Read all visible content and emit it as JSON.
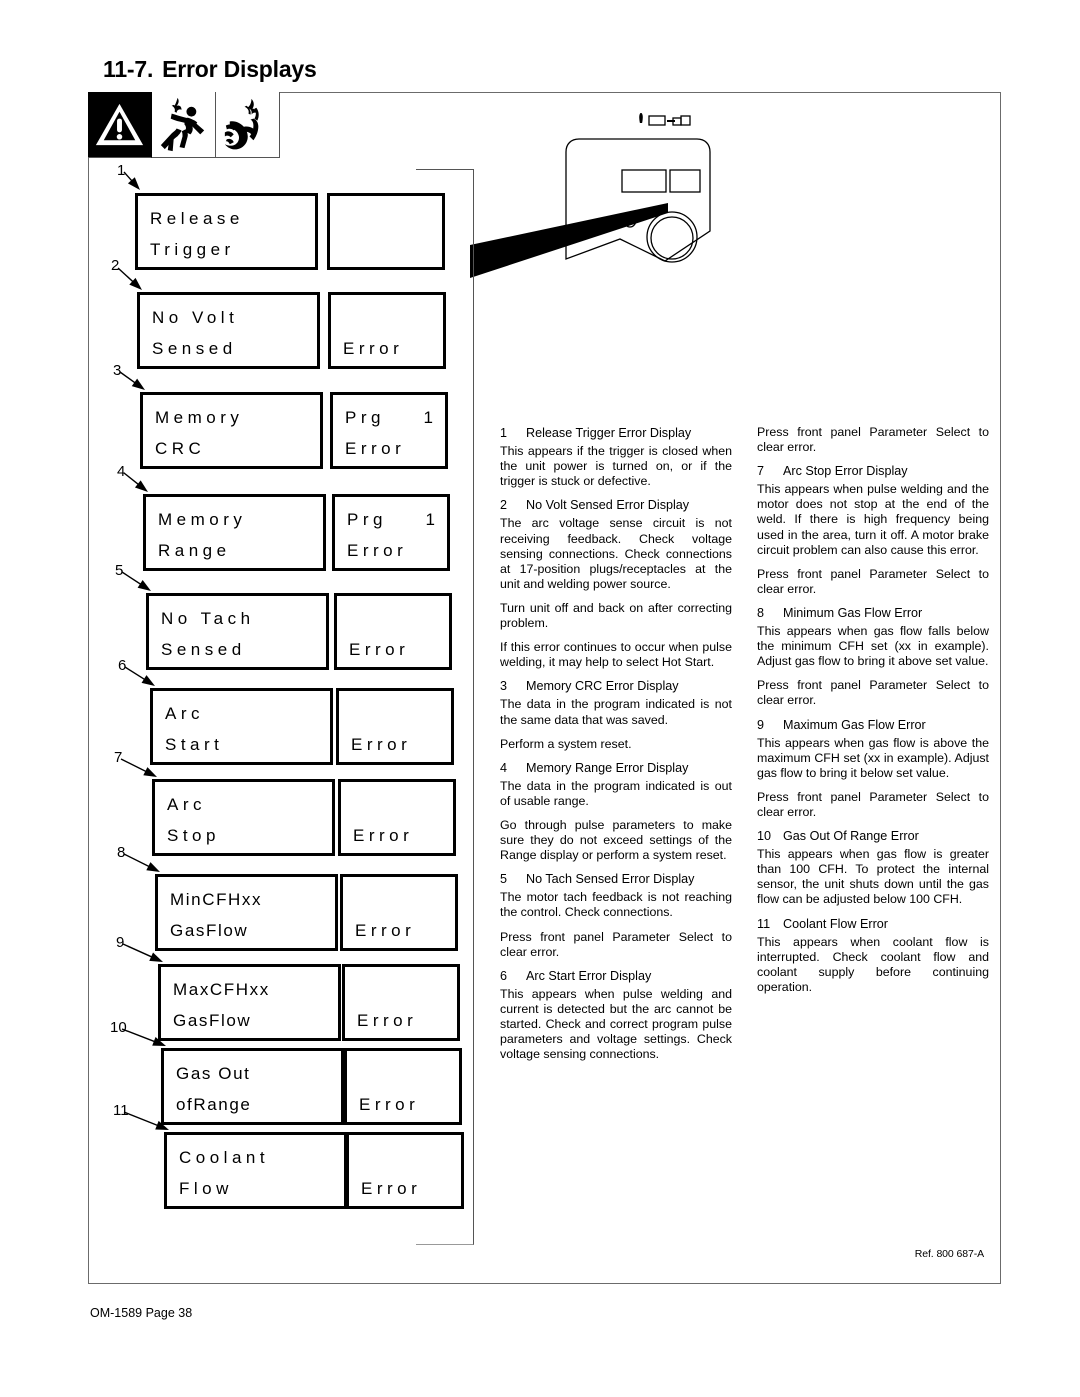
{
  "heading": {
    "number": "11-7.",
    "title": "Error Displays"
  },
  "safety_icons": [
    {
      "name": "warning-triangle-icon",
      "label": "Warning"
    },
    {
      "name": "electric-shock-icon",
      "label": "Electric Shock"
    },
    {
      "name": "moving-parts-hand-icon",
      "label": "Moving Parts Hand Injury"
    }
  ],
  "displays": [
    {
      "callout": "1",
      "left_line1": "Release",
      "left_line2": "Trigger",
      "right_line1": "",
      "right_num": "",
      "right_line2": ""
    },
    {
      "callout": "2",
      "left_line1": "No Volt",
      "left_line2": "Sensed",
      "right_line1": "",
      "right_num": "",
      "right_line2": "Error"
    },
    {
      "callout": "3",
      "left_line1": "Memory",
      "left_line2": "CRC",
      "right_line1": "Prg",
      "right_num": "1",
      "right_line2": "Error"
    },
    {
      "callout": "4",
      "left_line1": "Memory",
      "left_line2": "Range",
      "right_line1": "Prg",
      "right_num": "1",
      "right_line2": "Error"
    },
    {
      "callout": "5",
      "left_line1": "No Tach",
      "left_line2": "Sensed",
      "right_line1": "",
      "right_num": "",
      "right_line2": "Error"
    },
    {
      "callout": "6",
      "left_line1": "Arc",
      "left_line2": "Start",
      "right_line1": "",
      "right_num": "",
      "right_line2": "Error"
    },
    {
      "callout": "7",
      "left_line1": "Arc",
      "left_line2": "Stop",
      "right_line1": "",
      "right_num": "",
      "right_line2": "Error"
    },
    {
      "callout": "8",
      "left_line1": "MinCFHxx",
      "left_line2": "GasFlow",
      "right_line1": "",
      "right_num": "",
      "right_line2": "Error"
    },
    {
      "callout": "9",
      "left_line1": "MaxCFHxx",
      "left_line2": "GasFlow",
      "right_line1": "",
      "right_num": "",
      "right_line2": "Error"
    },
    {
      "callout": "10",
      "left_line1": "Gas Out",
      "left_line2": "ofRange",
      "right_line1": "",
      "right_num": "",
      "right_line2": "Error"
    },
    {
      "callout": "11",
      "left_line1": "Coolant",
      "left_line2": "Flow",
      "right_line1": "",
      "right_num": "",
      "right_line2": "Error"
    }
  ],
  "text_column_mid": [
    {
      "kind": "head",
      "idx": "1",
      "title": "Release Trigger Error Display"
    },
    {
      "kind": "para",
      "text": "This appears if the trigger is closed when the unit power is turned on, or if the trigger is stuck or defective."
    },
    {
      "kind": "head",
      "idx": "2",
      "title": "No Volt Sensed Error Display"
    },
    {
      "kind": "para",
      "text": "The arc voltage sense circuit is not receiving feedback. Check voltage sensing connections. Check connections at 17-position plugs/receptacles at the unit and welding power source."
    },
    {
      "kind": "para",
      "text": "Turn unit off and back on after correcting problem."
    },
    {
      "kind": "para",
      "text": "If this error continues to occur when pulse welding, it may help to select Hot Start."
    },
    {
      "kind": "head",
      "idx": "3",
      "title": "Memory CRC Error Display"
    },
    {
      "kind": "para",
      "text": "The data in the program indicated is not the same data that was saved."
    },
    {
      "kind": "para",
      "text": "Perform a system reset."
    },
    {
      "kind": "head",
      "idx": "4",
      "title": "Memory Range Error Display"
    },
    {
      "kind": "para",
      "text": "The data in the program indicated is out of usable range."
    },
    {
      "kind": "para",
      "text": "Go through pulse parameters to make sure they do not exceed settings of the Range display or perform a system reset."
    },
    {
      "kind": "head",
      "idx": "5",
      "title": "No Tach Sensed Error Display"
    },
    {
      "kind": "para",
      "text": "The motor tach feedback is not reaching the control. Check connections."
    },
    {
      "kind": "para",
      "text": "Press front panel Parameter Select to clear error."
    },
    {
      "kind": "head",
      "idx": "6",
      "title": "Arc Start Error Display"
    },
    {
      "kind": "para",
      "text": "This appears when pulse welding and current is detected but the arc cannot be started. Check and correct program pulse parameters and voltage settings. Check voltage sensing connections."
    }
  ],
  "text_column_right": [
    {
      "kind": "para",
      "text": "Press front panel Parameter Select to clear error."
    },
    {
      "kind": "head",
      "idx": "7",
      "title": "Arc Stop Error Display"
    },
    {
      "kind": "para",
      "text": "This appears when pulse welding and the motor does not stop at the end of the weld. If there is high frequency being used in the area, turn it off. A motor brake circuit problem can also cause this error."
    },
    {
      "kind": "para",
      "text": "Press front panel Parameter Select to clear error."
    },
    {
      "kind": "head",
      "idx": "8",
      "title": "Minimum Gas Flow Error"
    },
    {
      "kind": "para",
      "text": "This appears when gas flow falls below the minimum CFH set (xx in example). Adjust gas flow to bring it above set value."
    },
    {
      "kind": "para",
      "text": "Press front panel Parameter Select to clear error."
    },
    {
      "kind": "head",
      "idx": "9",
      "title": "Maximum Gas Flow Error"
    },
    {
      "kind": "para",
      "text": "This appears when gas flow is above the maximum CFH set (xx in example). Adjust gas flow to bring it below set value."
    },
    {
      "kind": "para",
      "text": "Press front panel Parameter Select to clear error."
    },
    {
      "kind": "head",
      "idx": "10",
      "title": "Gas Out Of Range Error"
    },
    {
      "kind": "para",
      "text": "This appears when gas flow is greater than 100 CFH. To protect the internal sensor, the unit shuts down until the gas flow can be adjusted below 100 CFH."
    },
    {
      "kind": "head",
      "idx": "11",
      "title": "Coolant Flow Error"
    },
    {
      "kind": "para",
      "text": "This appears when coolant flow is interrupted. Check coolant flow and coolant supply before continuing operation."
    }
  ],
  "ref_label": "Ref. 800 687-A",
  "footer": "OM-1589 Page 38"
}
